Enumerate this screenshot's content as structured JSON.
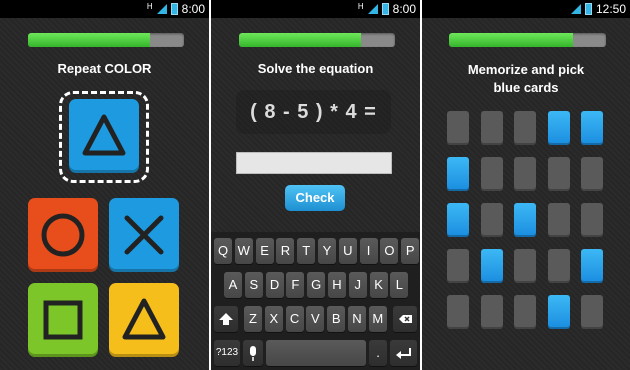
{
  "screens": [
    {
      "status_time": "8:00",
      "progress": 0.78,
      "title": "Repeat  COLOR",
      "shapes": [
        {
          "name": "triangle",
          "color": "#1e9be0"
        },
        {
          "name": "circle",
          "color": "#e84e1c"
        },
        {
          "name": "cross",
          "color": "#1e9be0"
        },
        {
          "name": "square",
          "color": "#7cc629"
        },
        {
          "name": "triangle",
          "color": "#f6be1a"
        }
      ]
    },
    {
      "status_time": "8:00",
      "progress": 0.78,
      "title": "Solve the equation",
      "equation": "( 8 - 5 ) * 4 =",
      "answer_value": "",
      "check_label": "Check",
      "keyboard": {
        "row1": [
          "Q",
          "W",
          "E",
          "R",
          "T",
          "Y",
          "U",
          "I",
          "O",
          "P"
        ],
        "row2": [
          "A",
          "S",
          "D",
          "F",
          "G",
          "H",
          "J",
          "K",
          "L"
        ],
        "row3": [
          "Z",
          "X",
          "C",
          "V",
          "B",
          "N",
          "M"
        ],
        "sym_label": "?123",
        "period_label": ".",
        "shift_icon": "shift-icon",
        "backspace_icon": "backspace-icon",
        "mic_icon": "mic-icon",
        "enter_icon": "enter-icon"
      }
    },
    {
      "status_time": "12:50",
      "progress": 0.79,
      "title_line1": "Memorize and pick",
      "title_line2": "blue cards",
      "cards": [
        [
          0,
          0,
          0,
          1,
          1
        ],
        [
          1,
          0,
          0,
          0,
          0
        ],
        [
          1,
          0,
          1,
          0,
          0
        ],
        [
          0,
          1,
          0,
          0,
          1
        ],
        [
          0,
          0,
          0,
          1,
          0
        ]
      ]
    }
  ],
  "colors": {
    "accent_blue": "#33b5e5",
    "progress_green": "#4ccf3e",
    "card_gray": "#5a5a5a",
    "card_blue": "#1a8ddf"
  }
}
